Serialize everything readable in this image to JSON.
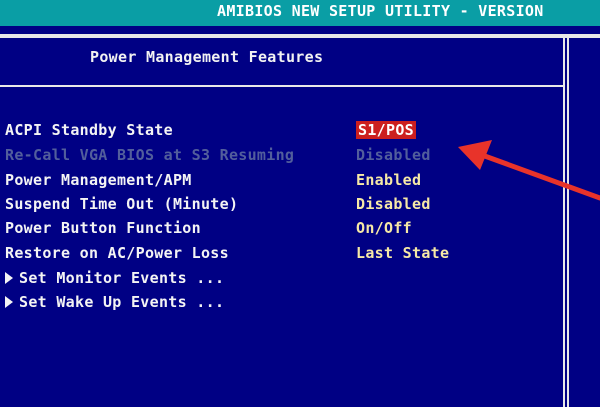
{
  "header": {
    "title": "AMIBIOS NEW SETUP UTILITY - VERSION"
  },
  "section": {
    "title": "Power Management Features"
  },
  "settings": [
    {
      "label": "ACPI Standby State",
      "value": "S1/POS",
      "selected": true,
      "disabled": false
    },
    {
      "label": "Re-Call VGA BIOS at S3 Resuming",
      "value": "Disabled",
      "selected": false,
      "disabled": true
    },
    {
      "label": "Power Management/APM",
      "value": "Enabled",
      "selected": false,
      "disabled": false
    },
    {
      "label": "Suspend Time Out (Minute)",
      "value": "Disabled",
      "selected": false,
      "disabled": false
    },
    {
      "label": "Power Button Function",
      "value": "On/Off",
      "selected": false,
      "disabled": false
    },
    {
      "label": "Restore on AC/Power Loss",
      "value": "Last State",
      "selected": false,
      "disabled": false
    }
  ],
  "submenus": [
    {
      "label": "Set Monitor Events ..."
    },
    {
      "label": "Set Wake Up Events ..."
    }
  ],
  "colors": {
    "background": "#000084",
    "title_bar": "#0a9ea5",
    "value_text": "#f6e9a6",
    "disabled_text": "#525e9c",
    "highlight": "#cc1f1f",
    "annotation_arrow": "#e8332a"
  },
  "icons": {
    "submenu": "right-triangle-icon",
    "annotation": "red-arrow-icon"
  }
}
